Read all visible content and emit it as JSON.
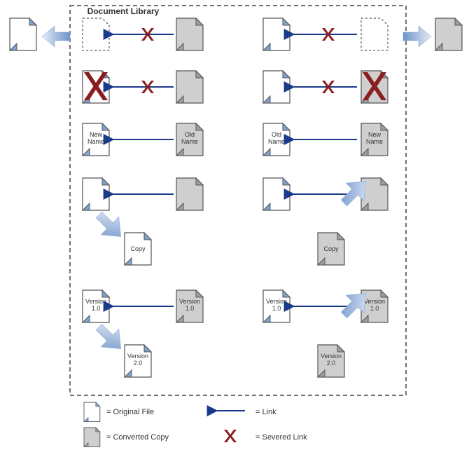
{
  "library_title": "Document Library",
  "rows": {
    "r3": {
      "left_original": "New\nName",
      "left_copy": "Old\nName",
      "right_original": "Old\nName",
      "right_copy": "New\nName"
    },
    "r4": {
      "copy_label_left": "Copy",
      "copy_label_right": "Copy"
    },
    "r5": {
      "v1": "Version\n1.0",
      "v2": "Version\n2.0"
    }
  },
  "legend": {
    "original": "= Original File",
    "converted": "= Converted Copy",
    "link": "= Link",
    "severed": "= Severed Link"
  }
}
